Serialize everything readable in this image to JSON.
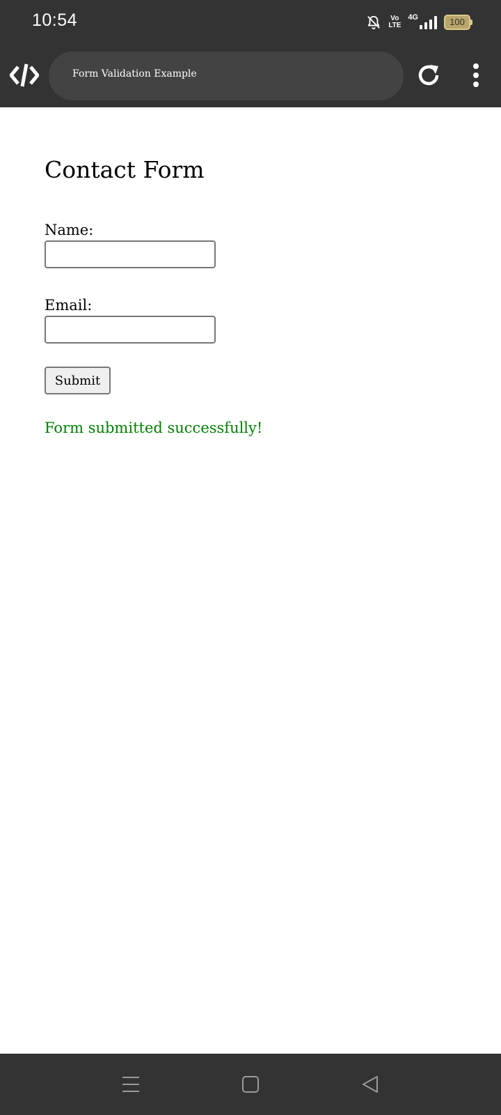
{
  "status_bar": {
    "time": "10:54",
    "volte_top": "Vo",
    "volte_bottom": "LTE",
    "network": "4G",
    "battery": "100",
    "icons": [
      "mute-bell-icon",
      "volte-icon",
      "signal-icon",
      "battery-icon"
    ]
  },
  "browser": {
    "page_title": "Form Validation Example",
    "icons": [
      "code-logo-icon",
      "reload-icon",
      "more-vertical-icon"
    ]
  },
  "page": {
    "heading": "Contact Form",
    "name_label": "Name:",
    "name_value": "",
    "email_label": "Email:",
    "email_value": "",
    "submit_label": "Submit",
    "success_message": "Form submitted successfully!"
  },
  "nav_bar": {
    "icons": [
      "menu-icon",
      "home-square-icon",
      "back-triangle-icon"
    ]
  },
  "colors": {
    "chrome_bg": "#333333",
    "pill_bg": "#434343",
    "success": "#008000",
    "battery": "#b8a56a"
  }
}
